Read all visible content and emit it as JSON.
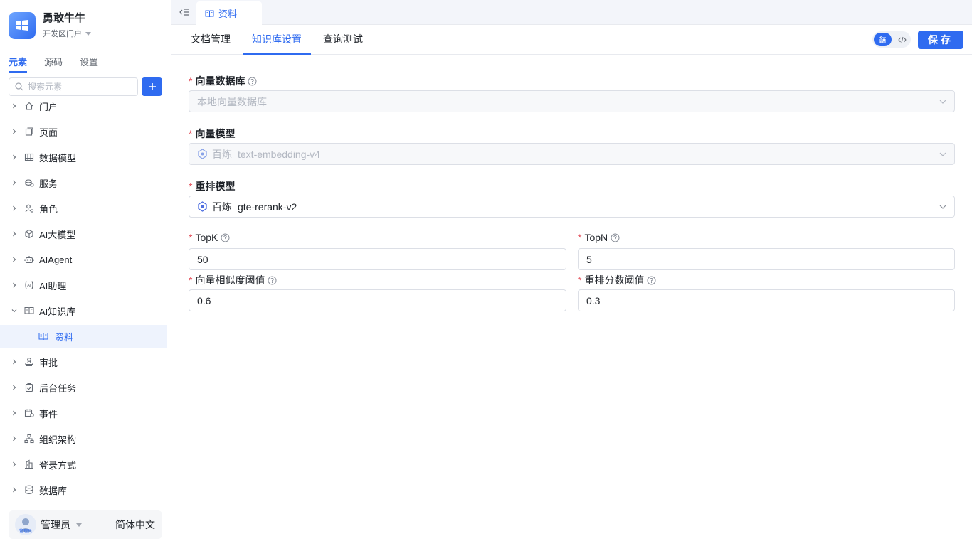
{
  "app": {
    "name": "勇敢牛牛",
    "subtitle": "开发区门户"
  },
  "sidebar": {
    "tabs": [
      {
        "label": "元素"
      },
      {
        "label": "源码"
      },
      {
        "label": "设置"
      }
    ],
    "search_placeholder": "搜索元素",
    "tree": [
      {
        "label": "门户",
        "icon": "home-icon"
      },
      {
        "label": "页面",
        "icon": "page-icon"
      },
      {
        "label": "数据模型",
        "icon": "table-icon"
      },
      {
        "label": "服务",
        "icon": "service-icon"
      },
      {
        "label": "角色",
        "icon": "role-icon"
      },
      {
        "label": "AI大模型",
        "icon": "cube-icon"
      },
      {
        "label": "AIAgent",
        "icon": "robot-icon"
      },
      {
        "label": "AI助理",
        "icon": "ai-assistant-icon"
      },
      {
        "label": "AI知识库",
        "icon": "book-icon",
        "expanded": true
      },
      {
        "label": "资料",
        "icon": "book-icon",
        "child": true,
        "selected": true
      },
      {
        "label": "审批",
        "icon": "stamp-icon"
      },
      {
        "label": "后台任务",
        "icon": "clipboard-check-icon"
      },
      {
        "label": "事件",
        "icon": "event-icon"
      },
      {
        "label": "组织架构",
        "icon": "org-chart-icon"
      },
      {
        "label": "登录方式",
        "icon": "building-icon"
      },
      {
        "label": "数据库",
        "icon": "database-icon"
      }
    ]
  },
  "user": {
    "name": "管理员",
    "avatar_label": "管理员",
    "language": "简体中文"
  },
  "topbar": {
    "tab_label": "资料"
  },
  "subnav": {
    "tabs": [
      {
        "label": "文档管理"
      },
      {
        "label": "知识库设置"
      },
      {
        "label": "查询测试"
      }
    ],
    "save_label": "保存"
  },
  "form": {
    "vector_db": {
      "label": "向量数据库",
      "value": "本地向量数据库"
    },
    "vector_model": {
      "label": "向量模型",
      "vendor": "百炼",
      "value": "text-embedding-v4"
    },
    "rerank_model": {
      "label": "重排模型",
      "vendor": "百炼",
      "value": "gte-rerank-v2"
    },
    "topk": {
      "label": "TopK",
      "value": "50"
    },
    "topn": {
      "label": "TopN",
      "value": "5"
    },
    "sim_threshold": {
      "label": "向量相似度阈值",
      "value": "0.6"
    },
    "rerank_threshold": {
      "label": "重排分数阈值",
      "value": "0.3"
    }
  },
  "colors": {
    "accent": "#2f6bf0",
    "required": "#e34d59"
  }
}
